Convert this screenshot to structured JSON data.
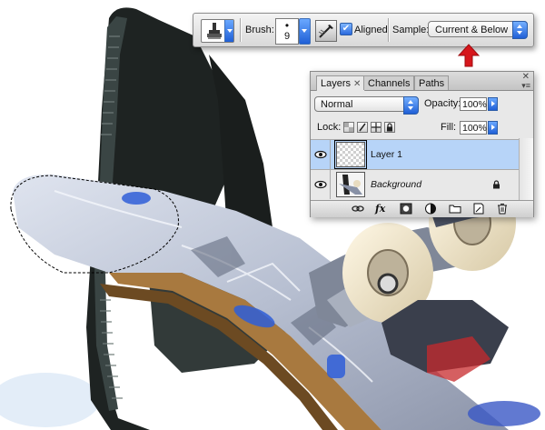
{
  "options_bar": {
    "brush_label": "Brush:",
    "brush_size": "9",
    "brush_tip_glyph": "•",
    "aligned_label": "Aligned",
    "aligned_checked": "✔",
    "sample_label": "Sample:",
    "sample_value": "Current & Below"
  },
  "layers_panel": {
    "tabs": [
      {
        "label": "Layers",
        "close": "✕"
      },
      {
        "label": "Channels"
      },
      {
        "label": "Paths"
      }
    ],
    "panel_close": "✕",
    "panel_menu": "▾≡",
    "blend_mode": "Normal",
    "opacity_label": "Opacity:",
    "opacity_value": "100%",
    "lock_label": "Lock:",
    "fill_label": "Fill:",
    "fill_value": "100%",
    "layers": [
      {
        "name": "Layer 1",
        "selected": true
      },
      {
        "name": "Background",
        "locked": true
      }
    ],
    "bottom_buttons": [
      "link-icon",
      "fx-icon",
      "mask-icon",
      "adjustment-icon",
      "group-folder-icon",
      "new-layer-icon",
      "trash-icon"
    ],
    "fx_label": "fx"
  },
  "colors": {
    "accent_blue": "#2a69dd",
    "selected_row": "#b7d4f8",
    "annotation_red": "#d6161b"
  }
}
